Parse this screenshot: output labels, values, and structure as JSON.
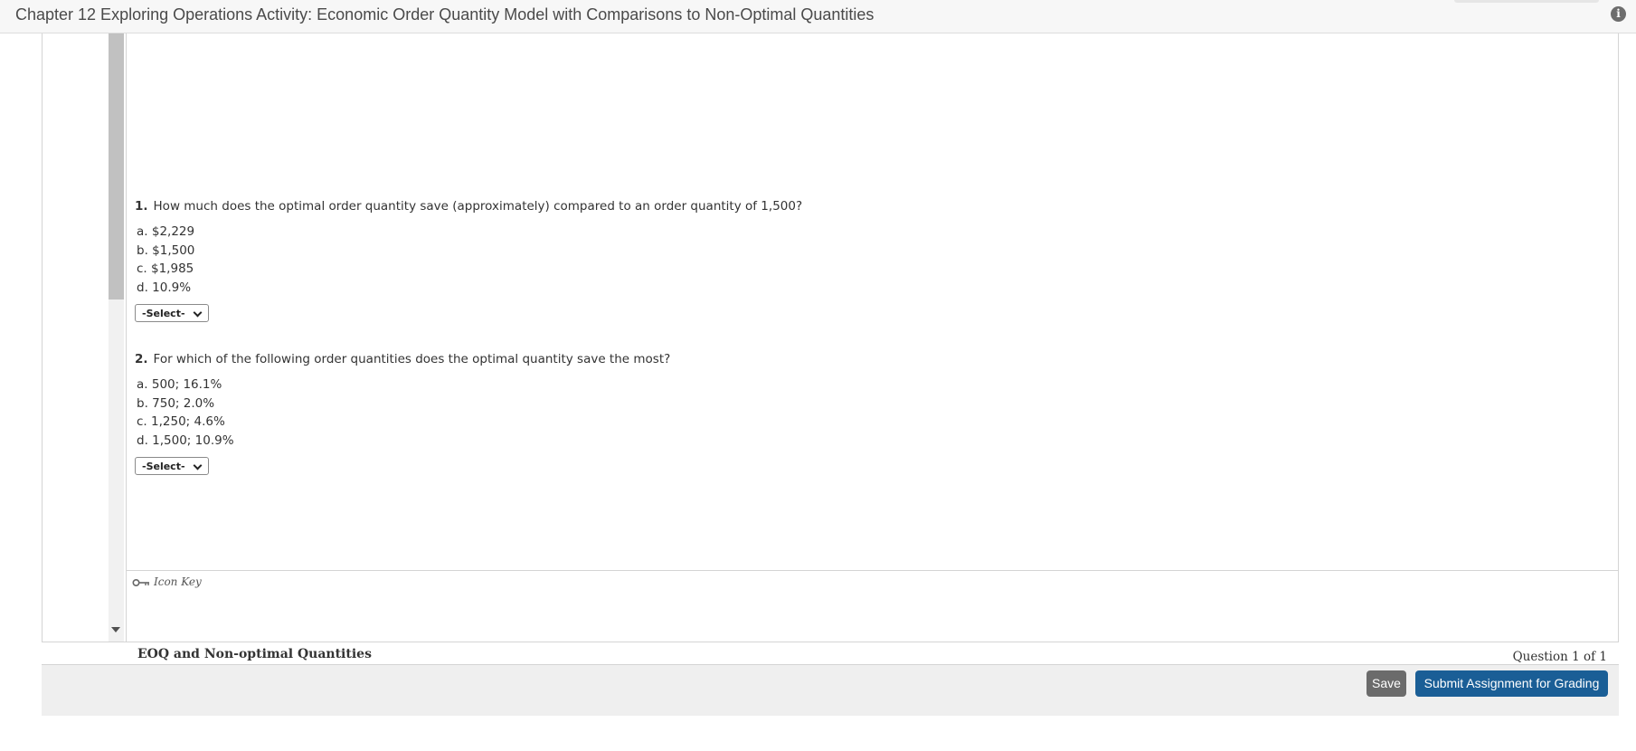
{
  "header": {
    "title": "Chapter 12 Exploring Operations Activity: Economic Order Quantity Model with Comparisons to Non-Optimal Quantities",
    "info_icon": "info-icon"
  },
  "questions": [
    {
      "number": "1.",
      "text": "How much does the optimal order quantity save (approximately) compared to an order quantity of 1,500?",
      "options": [
        "a. $2,229",
        "b. $1,500",
        "c. $1,985",
        "d. 10.9%"
      ],
      "select_value": "-Select-"
    },
    {
      "number": "2.",
      "text": "For which of the following order quantities does the optimal quantity save the most?",
      "options": [
        "a. 500; 16.1%",
        "b. 750; 2.0%",
        "c. 1,250; 4.6%",
        "d. 1,500; 10.9%"
      ],
      "select_value": "-Select-"
    }
  ],
  "icon_key": {
    "label": "Icon Key",
    "icon": "key-icon"
  },
  "footer": {
    "title": "EOQ and Non-optimal Quantities",
    "counter": "Question 1 of 1"
  },
  "actions": {
    "save_label": "Save",
    "submit_label": "Submit Assignment for Grading"
  }
}
